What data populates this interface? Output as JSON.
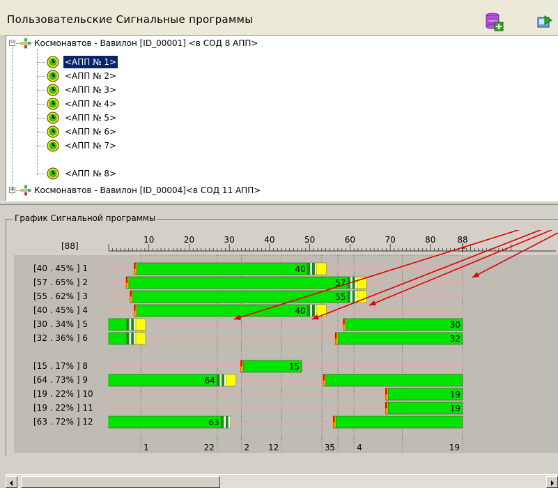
{
  "top_panel": {
    "title": "Пользовательские Сигнальные программы"
  },
  "tree": {
    "controllers": [
      {
        "label": "Космонавтов - Вавилон  [ID_00001]  <в СОД 8 АПП>",
        "expanded": true,
        "children": [
          {
            "label": "<АПП № 1>",
            "selected": true
          },
          {
            "label": "<АПП № 2>"
          },
          {
            "label": "<АПП № 3>"
          },
          {
            "label": "<АПП № 4>"
          },
          {
            "label": "<АПП № 5>"
          },
          {
            "label": "<АПП № 6>"
          },
          {
            "label": "<АПП № 7>"
          },
          {
            "label": "<АПП № 8>"
          }
        ]
      },
      {
        "label": "Космонавтов - Вавилон  [ID_00004]<в СОД 11 АПП>",
        "expanded": false
      }
    ]
  },
  "chart_panel": {
    "title": "График Сигнальной программы"
  },
  "colors": {
    "green": "#00e400",
    "yellow": "#ffff00",
    "grid": "#5a5a5a",
    "pink": "#ff9a9a",
    "arrow": "#e00000",
    "border": "#3a5a1a"
  },
  "chart_data": {
    "type": "timeline",
    "cycle_label": "[88]",
    "ruler_ticks": [
      10,
      20,
      30,
      40,
      50,
      60,
      70,
      80,
      88
    ],
    "x_range": [
      0,
      88
    ],
    "phase_boundaries": [
      8,
      27,
      33,
      43,
      53,
      57,
      61,
      73,
      88
    ],
    "phase_labels": [
      "1",
      "22",
      "2",
      "12",
      "3",
      "5",
      "4",
      "19"
    ],
    "rows": [
      {
        "label": "[40 . 45% ]   1",
        "bars": [
          {
            "start": 6.5,
            "end": 49.5,
            "value": "40",
            "tail": "stripe+yellow"
          }
        ]
      },
      {
        "label": "[57 . 65% ]   2",
        "bars": [
          {
            "start": 4.5,
            "end": 59.5,
            "value": "57",
            "tail": "stripe+yellow"
          }
        ]
      },
      {
        "label": "[55 . 62% ]   3",
        "bars": [
          {
            "start": 5.5,
            "end": 59.5,
            "value": "55",
            "tail": "stripe+yellow"
          }
        ]
      },
      {
        "label": "[40 . 45% ]   4",
        "bars": [
          {
            "start": 6.5,
            "end": 49.5,
            "value": "40",
            "tail": "stripe+yellow"
          }
        ]
      },
      {
        "label": "[30 . 34% ]   5",
        "bars": [
          {
            "start": 0,
            "end": 4.5,
            "value": "",
            "tail": "stripe+yellow"
          },
          {
            "start": 58.5,
            "end": 88,
            "value": "30",
            "tail": ""
          }
        ]
      },
      {
        "label": "[32 . 36% ]   6",
        "bars": [
          {
            "start": 0,
            "end": 4.5,
            "value": "",
            "tail": "stripe+yellow"
          },
          {
            "start": 56.5,
            "end": 88,
            "value": "32",
            "tail": ""
          }
        ]
      },
      {
        "label": "",
        "bars": []
      },
      {
        "label": "[15 . 17% ]   8",
        "bars": [
          {
            "start": 33,
            "end": 48,
            "value": "15",
            "tail": ""
          }
        ]
      },
      {
        "label": "[64 . 73% ]   9",
        "bars": [
          {
            "start": 0,
            "end": 27,
            "value": "64",
            "tail": "stripe+yellow"
          },
          {
            "start": 53.5,
            "end": 88,
            "value": "",
            "tail": ""
          }
        ]
      },
      {
        "label": "[19 . 22% ] 10",
        "bars": [
          {
            "start": 69,
            "end": 88,
            "value": "19",
            "tail": ""
          }
        ]
      },
      {
        "label": "[19 . 22% ] 11",
        "bars": [
          {
            "start": 69,
            "end": 88,
            "value": "19",
            "tail": ""
          }
        ]
      },
      {
        "label": "[63 . 72% ] 12",
        "bars": [
          {
            "start": 0,
            "end": 28,
            "value": "63",
            "tail": "stripe"
          },
          {
            "start": 56,
            "end": 88,
            "value": "",
            "tail": ""
          }
        ]
      }
    ]
  }
}
